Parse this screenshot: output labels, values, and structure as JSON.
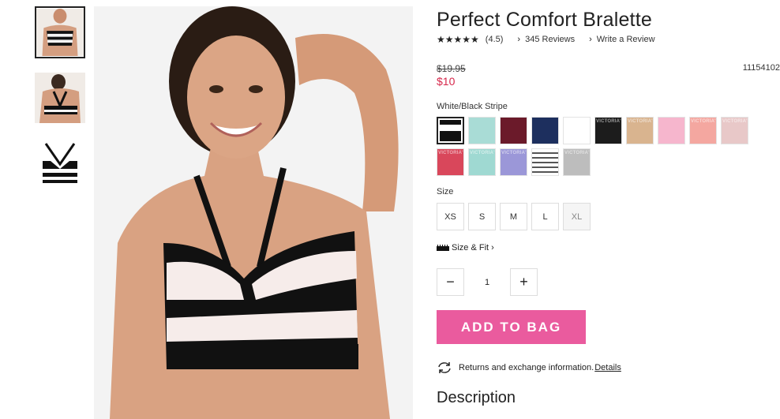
{
  "product": {
    "title": "Perfect Comfort Bralette",
    "stars": "★★★★★",
    "rating": "(4.5)",
    "reviews": "345 Reviews",
    "write_review": "Write a Review",
    "old_price": "$19.95",
    "sale_price": "$10",
    "sku": "11154102",
    "rating_value": 4.5
  },
  "color": {
    "selected_label": "White/Black Stripe",
    "swatches": [
      {
        "name": "White/Black Stripe",
        "color": "#ffffff"
      },
      {
        "name": "Mint",
        "color": "#a9dcd6"
      },
      {
        "name": "Burgundy",
        "color": "#6b1a2a"
      },
      {
        "name": "Navy",
        "color": "#1d2f5e"
      },
      {
        "name": "White",
        "color": "#ffffff"
      },
      {
        "name": "Black",
        "color": "#1c1c1c"
      },
      {
        "name": "Nude",
        "color": "#d9b48f"
      },
      {
        "name": "Pink",
        "color": "#f6b6cd"
      },
      {
        "name": "Coral Logo",
        "color": "#f4a7a0"
      },
      {
        "name": "Blush Logo",
        "color": "#e8c8c8"
      },
      {
        "name": "Red Logo",
        "color": "#d9475b"
      },
      {
        "name": "Aqua Logo",
        "color": "#9fd9d2"
      },
      {
        "name": "Lavender Logo",
        "color": "#9b97d8"
      },
      {
        "name": "Grey Stripe",
        "color": "#d9d9d9"
      },
      {
        "name": "Heather Grey",
        "color": "#bdbdbd"
      }
    ],
    "logo_text": "VICTORIA'S SECRET"
  },
  "size": {
    "label": "Size",
    "options": [
      "XS",
      "S",
      "M",
      "L",
      "XL"
    ],
    "fit_link": "Size & Fit"
  },
  "quantity": {
    "minus": "−",
    "value": "1",
    "plus": "+"
  },
  "actions": {
    "add_to_bag": "ADD TO BAG"
  },
  "returns": {
    "text": "Returns and exchange information.",
    "link": "Details"
  },
  "description": {
    "heading": "Description"
  },
  "colors": {
    "accent": "#ea5b9e",
    "sale": "#d6264a"
  }
}
